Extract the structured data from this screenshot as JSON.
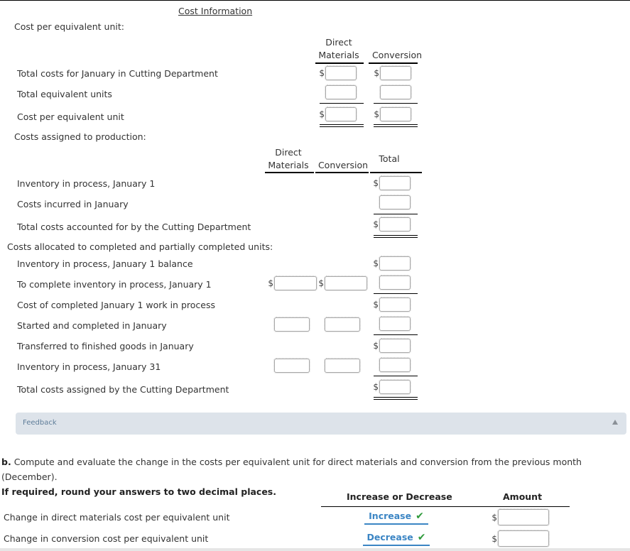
{
  "section_title": "Cost Information",
  "cost_per_eu": {
    "heading": "Cost per equivalent unit:",
    "columns": [
      "Direct\nMaterials",
      "Conversion"
    ],
    "col_dm_line1": "Direct",
    "col_dm_line2": "Materials",
    "col_conv": "Conversion",
    "rows": [
      {
        "label": "Total costs for January in Cutting Department",
        "dm_value": "",
        "conv_value": "",
        "currency": "$"
      },
      {
        "label": "Total equivalent units",
        "dm_value": "",
        "conv_value": ""
      },
      {
        "label": "Cost per equivalent unit",
        "dm_value": "",
        "conv_value": "",
        "currency": "$"
      }
    ]
  },
  "costs_assigned": {
    "heading": "Costs assigned to production:",
    "col_dm_line1": "Direct",
    "col_dm_line2": "Materials",
    "col_conv": "Conversion",
    "col_total": "Total",
    "rows": [
      {
        "label": "Inventory in process, January 1",
        "total_value": "",
        "currency": "$"
      },
      {
        "label": "Costs incurred in January",
        "total_value": ""
      },
      {
        "label": "Total costs accounted for by the Cutting Department",
        "total_value": "",
        "currency": "$"
      }
    ]
  },
  "allocation": {
    "heading": "Costs allocated to completed and partially completed units:",
    "rows": [
      {
        "label": "Inventory in process, January 1 balance",
        "total_value": "",
        "currency": "$"
      },
      {
        "label": "To complete inventory in process, January 1",
        "dm_value": "",
        "conv_value": "",
        "total_value": "",
        "currency": "$"
      },
      {
        "label": "Cost of completed January 1 work in process",
        "total_value": "",
        "currency": "$"
      },
      {
        "label": "Started and completed in January",
        "dm_value": "",
        "conv_value": "",
        "total_value": ""
      },
      {
        "label": "Transferred to finished goods in January",
        "total_value": "",
        "currency": "$"
      },
      {
        "label": "Inventory in process, January 31",
        "dm_value": "",
        "conv_value": "",
        "total_value": ""
      },
      {
        "label": "Total costs assigned by the Cutting Department",
        "total_value": "",
        "currency": "$"
      }
    ]
  },
  "feedback": {
    "label": "Feedback",
    "toggle_icon": "caret-up-icon"
  },
  "part_b": {
    "letter": "b.",
    "instruction": "Compute and evaluate the change in the costs per equivalent unit for direct materials and conversion from the previous month (December).",
    "rounding_note": "If required, round your answers to two decimal places.",
    "col_direction": "Increase or Decrease",
    "col_amount": "Amount",
    "rows": [
      {
        "label": "Change in direct materials cost per equivalent unit",
        "direction": "Increase",
        "status": "correct",
        "amount": "",
        "currency": "$"
      },
      {
        "label": "Change in conversion cost per equivalent unit",
        "direction": "Decrease",
        "status": "correct",
        "amount": "",
        "currency": "$"
      }
    ]
  },
  "colors": {
    "link_blue": "#3b85c4",
    "check_green": "#2e9a3b",
    "feedback_bg": "#dde3ea"
  }
}
